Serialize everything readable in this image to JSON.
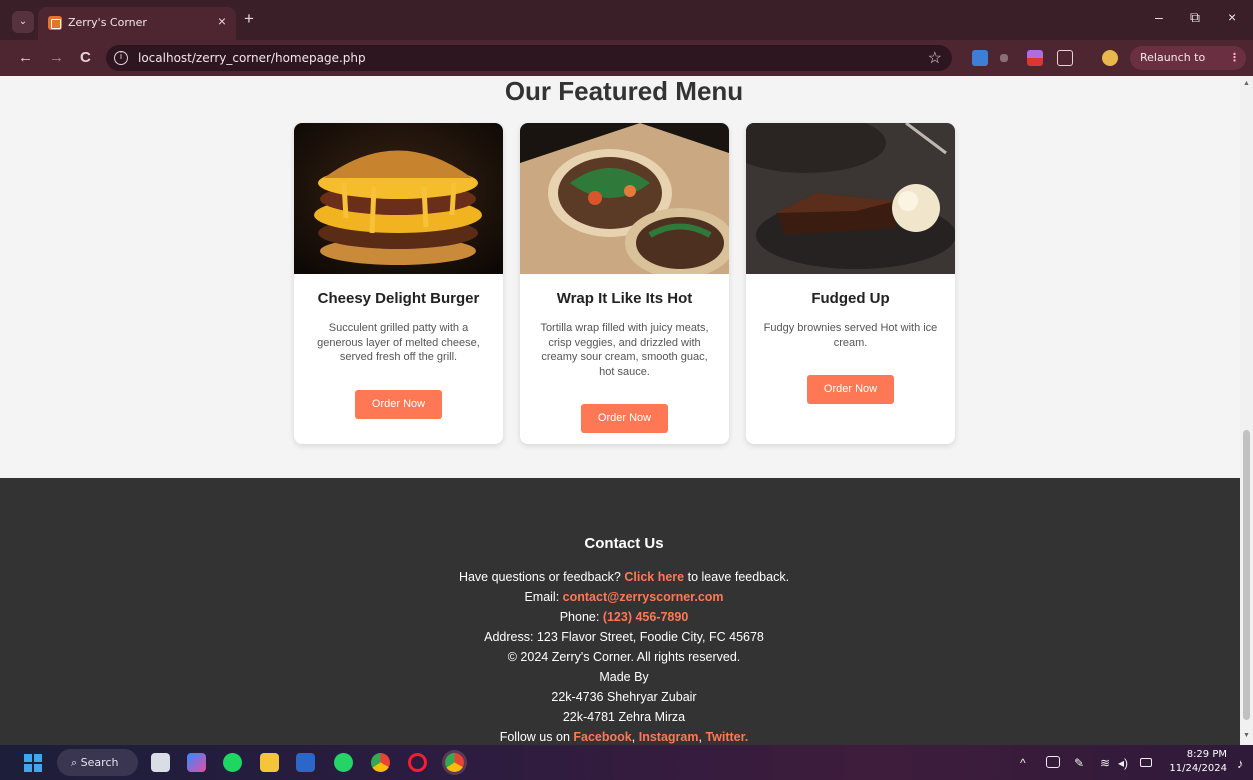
{
  "browser": {
    "tab_title": "Zerry's Corner",
    "tab_close": "×",
    "new_tab": "+",
    "url": "localhost/zerry_corner/homepage.php",
    "relaunch_label": "Relaunch to update",
    "relaunch_menu": "⋮",
    "window_controls": {
      "minimize": "–",
      "restore": "⧉",
      "close": "×"
    },
    "nav": {
      "back": "←",
      "forward": "→",
      "reload": "C"
    },
    "star": "☆",
    "tab_search": "⌄",
    "info": "i"
  },
  "menu": {
    "title": "Our Featured Menu",
    "items": [
      {
        "name": "Cheesy Delight Burger",
        "description": "Succulent grilled patty with a generous layer of melted cheese, served fresh off the grill.",
        "button": "Order Now"
      },
      {
        "name": "Wrap It Like Its Hot",
        "description": "Tortilla wrap filled with juicy meats, crisp veggies, and drizzled with creamy sour cream, smooth guac, hot sauce.",
        "button": "Order Now"
      },
      {
        "name": "Fudged Up",
        "description": "Fudgy brownies served Hot with ice cream.",
        "button": "Order Now"
      }
    ]
  },
  "footer": {
    "title": "Contact Us",
    "feedback_pre": "Have questions or feedback?",
    "feedback_link": "Click here",
    "feedback_post": "to leave feedback.",
    "email_label": "Email:",
    "email": "contact@zerryscorner.com",
    "phone_label": "Phone:",
    "phone": "(123) 456-7890",
    "address": "Address: 123 Flavor Street, Foodie City, FC 45678",
    "copyright": "© 2024 Zerry's Corner. All rights reserved.",
    "made_by": "Made By",
    "author1": "22k-4736 Shehryar Zubair",
    "author2": "22k-4781 Zehra Mirza",
    "follow_label": "Follow us on",
    "facebook": "Facebook",
    "instagram": "Instagram",
    "twitter": "Twitter",
    "sep1": ",",
    "sep2": ",",
    "end": "."
  },
  "taskbar": {
    "search": "Search",
    "time": "8:29 PM",
    "date": "11/24/2024"
  },
  "colors": {
    "accent": "#ff7855",
    "footer_bg": "#333333",
    "chrome_bg": "#3a1e28"
  }
}
